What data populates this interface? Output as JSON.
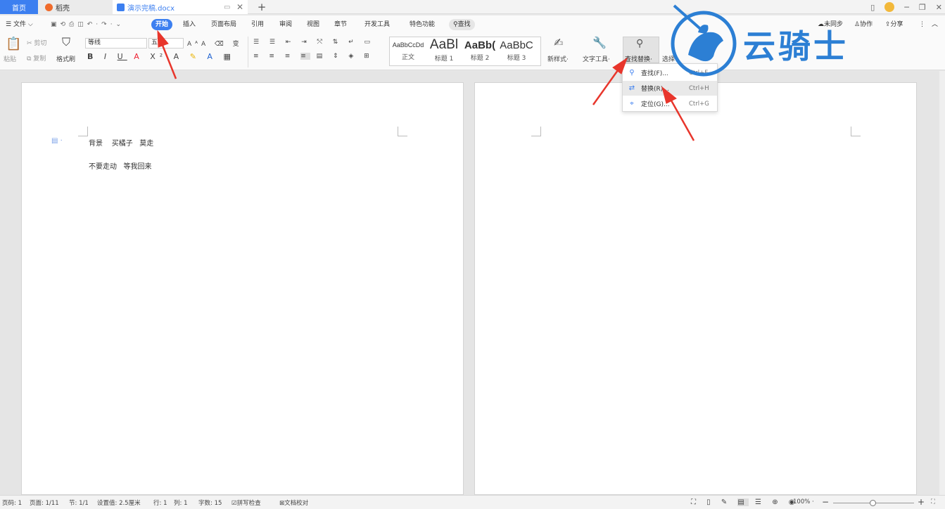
{
  "titlebar": {
    "tabs": [
      {
        "label": "首页"
      },
      {
        "label": "稻壳"
      },
      {
        "label": "演示完稿.docx"
      }
    ],
    "new_tab": "+"
  },
  "menu": {
    "file": "文件",
    "items": [
      "开始",
      "插入",
      "页面布局",
      "引用",
      "审阅",
      "视图",
      "章节",
      "开发工具",
      "特色功能"
    ],
    "search": "查找",
    "right": {
      "sync": "未同步",
      "collab": "协作",
      "share": "分享"
    }
  },
  "ribbon": {
    "paste": "粘贴",
    "cut": "剪切",
    "copy": "复制",
    "format_painter": "格式刷",
    "font_name": "等线",
    "font_size": "五",
    "styles": [
      {
        "preview": "AaBbCcDd",
        "label": "正文"
      },
      {
        "preview": "AaBl",
        "label": "标题 1"
      },
      {
        "preview": "AaBb(",
        "label": "标题 2"
      },
      {
        "preview": "AaBbC",
        "label": "标题 3"
      }
    ],
    "new_style": "新样式",
    "text_tools": "文字工具",
    "find_replace": "查找替换",
    "select": "选择"
  },
  "dropdown": [
    {
      "label": "查找(F)...",
      "shortcut": "Ctrl+F"
    },
    {
      "label": "替换(R)...",
      "shortcut": "Ctrl+H"
    },
    {
      "label": "定位(G)...",
      "shortcut": "Ctrl+G"
    }
  ],
  "document": {
    "line1": "背景    买橘子   莫走",
    "line2": "不要走动   等我回来"
  },
  "statusbar": {
    "page_code": "页码: 1",
    "pages": "页面: 1/11",
    "section": "节: 1/1",
    "setting": "设置值: 2.5厘米",
    "row": "行: 1",
    "col": "列: 1",
    "words": "字数: 15",
    "spell": "拼写检查",
    "proof": "文档校对",
    "zoom": "100%"
  },
  "watermark": {
    "text": "云骑士"
  },
  "colors": {
    "accent": "#3c7ff0",
    "watermark": "#2c7fd4",
    "arrow": "#e8362c"
  }
}
